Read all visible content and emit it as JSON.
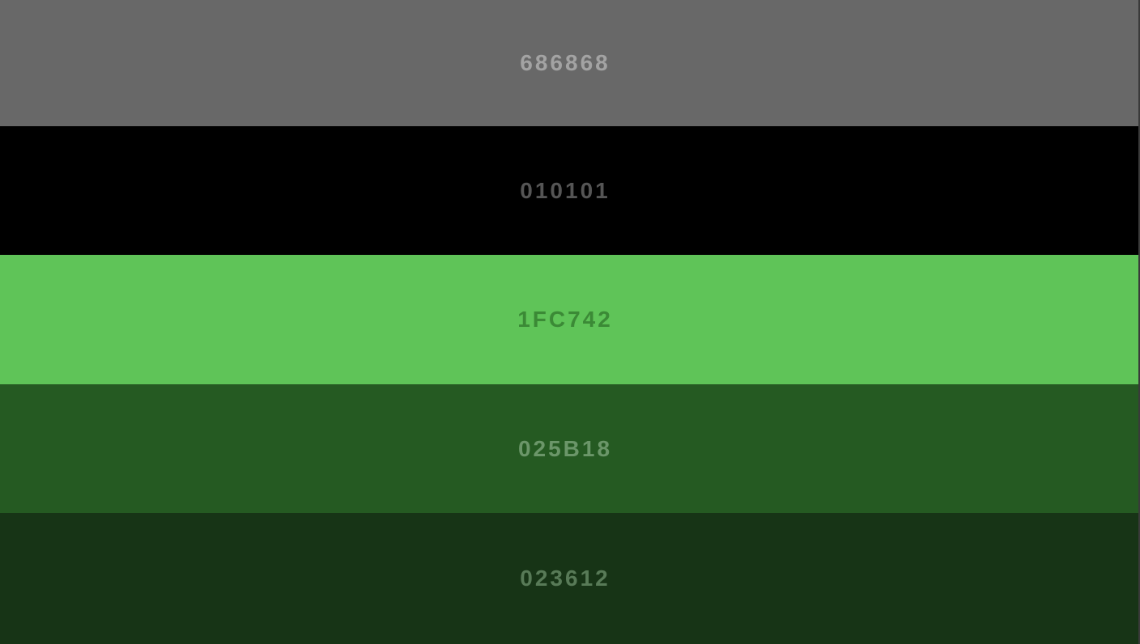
{
  "palette": {
    "swatches": [
      {
        "label": "686868",
        "color": "#686868",
        "text_color": "#a3a3a3"
      },
      {
        "label": "010101",
        "color": "#000000",
        "text_color": "#555555"
      },
      {
        "label": "1FC742",
        "color": "#5fc458",
        "text_color": "#3b8a36"
      },
      {
        "label": "025B18",
        "color": "#255a22",
        "text_color": "#6b9669"
      },
      {
        "label": "023612",
        "color": "#173416",
        "text_color": "#587a57"
      }
    ]
  }
}
